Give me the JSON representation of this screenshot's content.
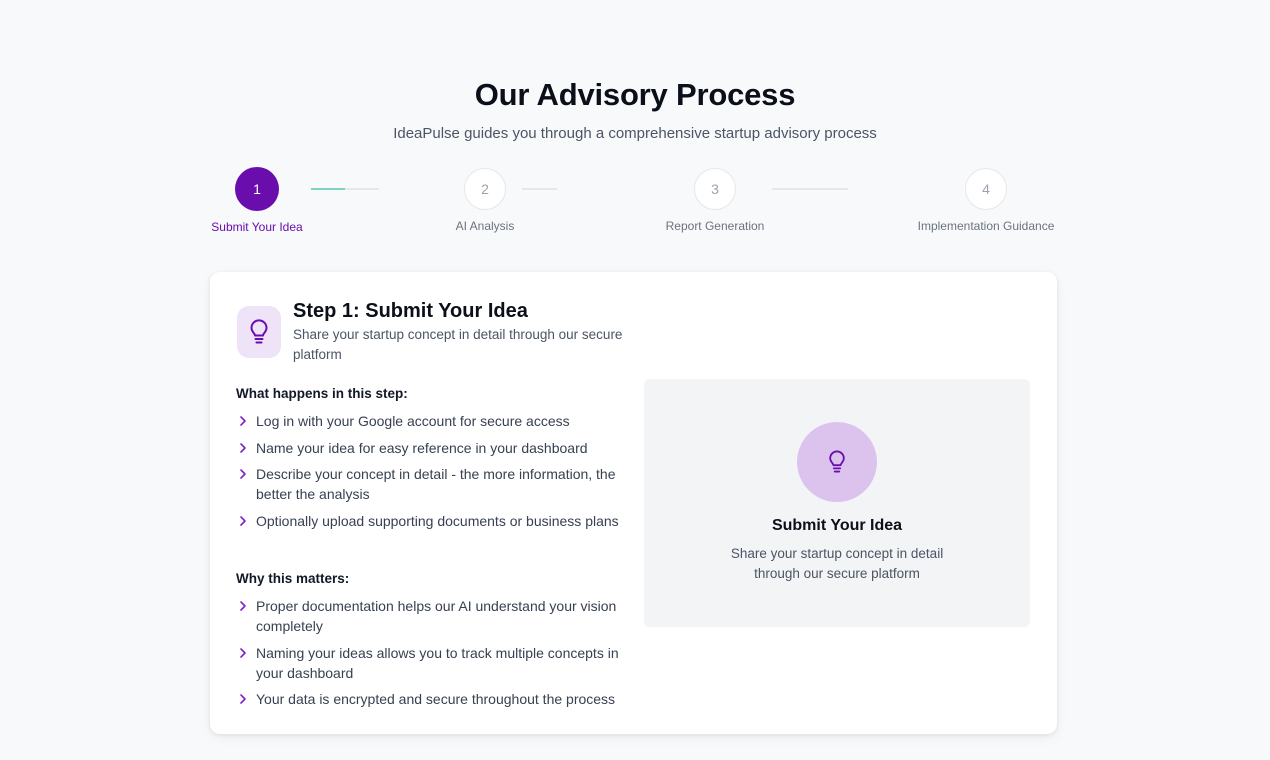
{
  "header": {
    "title": "Our Advisory Process",
    "subtitle": "IdeaPulse guides you through a comprehensive startup advisory process"
  },
  "stepper": {
    "steps": [
      {
        "number": "1",
        "label": "Submit Your Idea"
      },
      {
        "number": "2",
        "label": "AI Analysis"
      },
      {
        "number": "3",
        "label": "Report Generation"
      },
      {
        "number": "4",
        "label": "Implementation Guidance"
      }
    ],
    "active_step": 1,
    "first_connector_progress": 0.5
  },
  "card": {
    "icon": "lightbulb-icon",
    "title": "Step 1: Submit Your Idea",
    "description": "Share your startup concept in detail through our secure platform",
    "what_happens": {
      "heading": "What happens in this step:",
      "items": [
        "Log in with your Google account for secure access",
        "Name your idea for easy reference in your dashboard",
        "Describe your concept in detail - the more information, the better the analysis",
        "Optionally upload supporting documents or business plans"
      ]
    },
    "why_matters": {
      "heading": "Why this matters:",
      "items": [
        "Proper documentation helps our AI understand your vision completely",
        "Naming your ideas allows you to track multiple concepts in your dashboard",
        "Your data is encrypted and secure throughout the process"
      ]
    },
    "preview": {
      "icon": "lightbulb-icon",
      "title": "Submit Your Idea",
      "description": "Share your startup concept in detail through our secure platform"
    }
  },
  "colors": {
    "accent": "#6a0dad",
    "accent_light": "#efe3f8",
    "progress": "#7dd3c0",
    "background": "#f8f9fb"
  }
}
